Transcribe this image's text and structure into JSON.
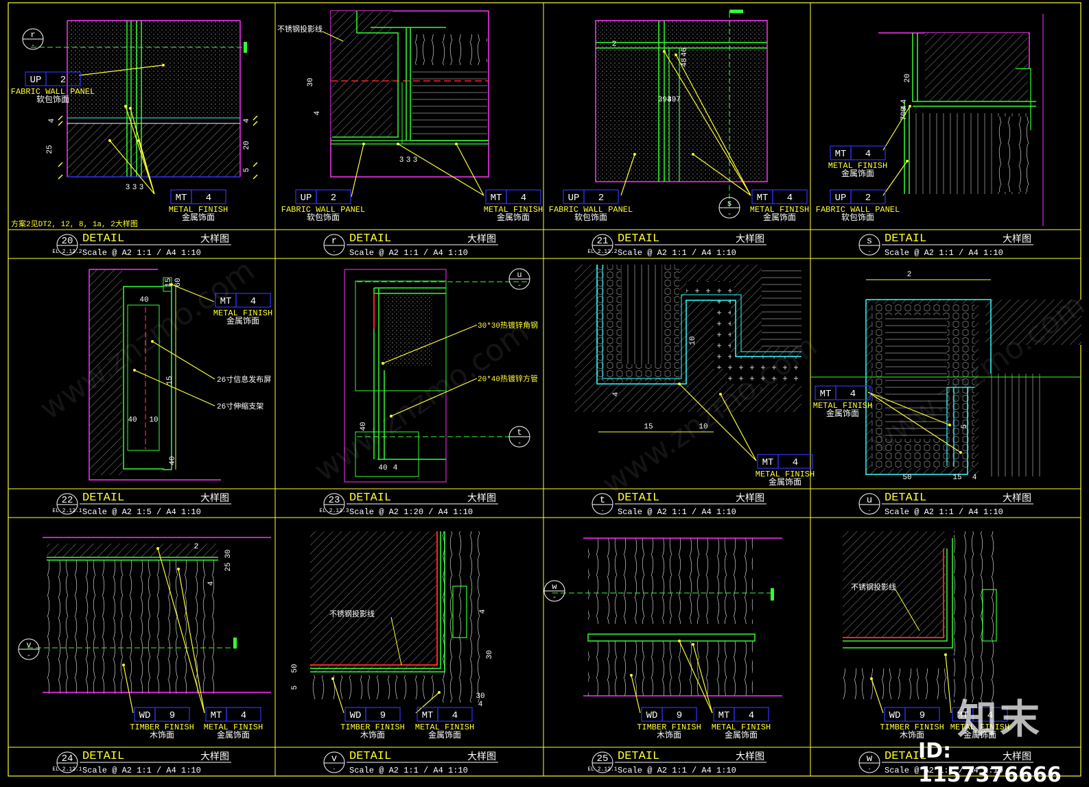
{
  "colors": {
    "frame": "#ffff33",
    "green": "#33ff33",
    "magenta": "#ff33ff",
    "red": "#ff2222",
    "cyan": "#33ffff",
    "white": "#ffffff",
    "blue": "#3333ff",
    "gray": "#888888"
  },
  "labels": {
    "detail": "DETAIL",
    "dayangtu": "大样图",
    "up_code": "UP",
    "up_num": "2",
    "mt_code": "MT",
    "mt_num": "4",
    "wd_code": "WD",
    "wd_num": "9",
    "fabric_en": "FABRIC WALL PANEL",
    "fabric_cn": "软包饰面",
    "metal_en": "METAL FINISH",
    "metal_cn": "金属饰面",
    "timber_en": "TIMBER FINISH",
    "timber_cn": "木饰面",
    "ss_line": "不锈钢投影线"
  },
  "note_scheme": "方案2见DT2, 12, 8, 1a, 2大样图",
  "notes_22": [
    "26寸信息发布屏",
    "26寸伸缩支架"
  ],
  "notes_23": [
    "30*30热镀锌角钢",
    "20*40热镀锌方管"
  ],
  "panels": [
    {
      "id": "20",
      "sub": "EL 2.12.2",
      "scale": "Scale @ A2 1:1 / A4 1:10"
    },
    {
      "id": "r",
      "sub": "-",
      "scale": "Scale @ A2 1:1 / A4 1:10"
    },
    {
      "id": "21",
      "sub": "EL 2.12.2",
      "scale": "Scale @ A2 1:1 / A4 1:10"
    },
    {
      "id": "s",
      "sub": "-",
      "scale": "Scale @ A2 1:1 / A4 1:10"
    },
    {
      "id": "22",
      "sub": "EL 2.12.1",
      "scale": "Scale @ A2 1:5 / A4 1:10"
    },
    {
      "id": "23",
      "sub": "EL 2.12.3",
      "scale": "Scale @ A2 1:20 / A4 1:10"
    },
    {
      "id": "t",
      "sub": "-",
      "scale": "Scale @ A2 1:1 / A4 1:10"
    },
    {
      "id": "u",
      "sub": "-",
      "scale": "Scale @ A2 1:1 / A4 1:10"
    },
    {
      "id": "24",
      "sub": "EL 2.12.1",
      "scale": "Scale @ A2 1:1 / A4 1:10"
    },
    {
      "id": "v",
      "sub": "-",
      "scale": "Scale @ A2 1:1 / A4 1:10"
    },
    {
      "id": "25",
      "sub": "EL 2.12.1",
      "scale": "Scale @ A2 1:1 / A4 1:10"
    },
    {
      "id": "w",
      "sub": "-",
      "scale": "Scale @ A2 1:1 / A4 1:10"
    }
  ],
  "section_markers": [
    "r",
    "-",
    "s",
    "-",
    "u",
    "-",
    "t",
    "-",
    "v",
    "-",
    "w",
    "-"
  ],
  "dims": [
    "25",
    "20",
    "5",
    "4",
    "4",
    "3",
    "3",
    "3",
    "30",
    "4",
    "3",
    "3",
    "3",
    "2",
    "3",
    "94",
    "397",
    "46",
    "48",
    "20",
    "4",
    "4",
    "700",
    "40",
    "15",
    "40",
    "10",
    "40",
    "15",
    "60",
    "40",
    "40",
    "4",
    "10",
    "15",
    "10",
    "4",
    "2",
    "5",
    "50",
    "15",
    "4",
    "2",
    "30",
    "25",
    "4",
    "4",
    "30",
    "5",
    "50",
    "30",
    "4"
  ],
  "watermarks": [
    "www.znzmo.com",
    "知末网",
    "www.znzmo.com",
    "知末网",
    "www.znzmo.com",
    "知末网",
    "www.znzmo.com",
    "知末网"
  ],
  "brand_logo": "知末",
  "id_text": "ID: 1157376666"
}
